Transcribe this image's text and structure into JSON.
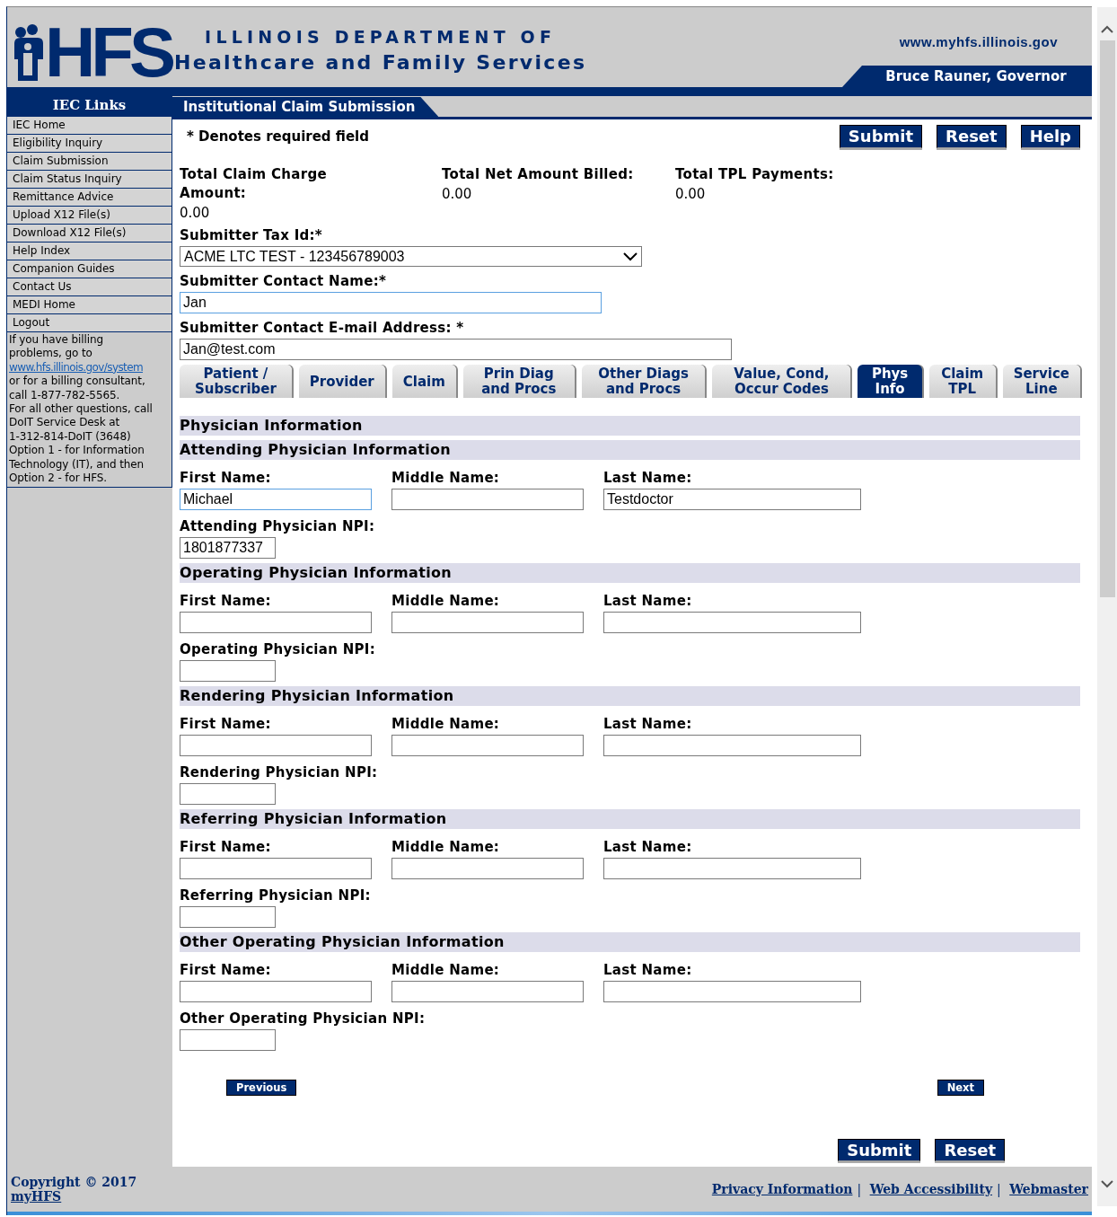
{
  "header": {
    "logo_text": "HFS",
    "title_line1": "ILLINOIS DEPARTMENT OF",
    "title_line2": "Healthcare and Family Services",
    "url": "www.myhfs.illinois.gov",
    "governor": "Bruce Rauner, Governor"
  },
  "sidebar": {
    "title": "IEC Links",
    "items": [
      "IEC Home",
      "Eligibility Inquiry",
      "Claim Submission",
      "Claim Status Inquiry",
      "Remittance Advice",
      "Upload X12 File(s)",
      "Download X12 File(s)",
      "Help Index",
      "Companion Guides",
      "Contact Us",
      "MEDI Home",
      "Logout"
    ],
    "note_before": [
      "If you have billing",
      "problems, go to"
    ],
    "note_link": "www.hfs.illinois.gov/system",
    "note_after": [
      "or for a billing consultant,",
      "call 1-877-782-5565.",
      "For all other questions, call",
      "DoIT Service Desk at",
      "1-312-814-DoIT (3648)",
      "Option 1 - for Information",
      "Technology (IT), and then",
      "Option 2 - for HFS."
    ]
  },
  "page_tab": "Institutional Claim Submission",
  "required_note": "* Denotes required field",
  "top_buttons": [
    "Submit",
    "Reset",
    "Help"
  ],
  "totals": [
    {
      "label": "Total Claim Charge Amount:",
      "value": "0.00"
    },
    {
      "label": "Total Net Amount Billed:",
      "value": "0.00"
    },
    {
      "label": "Total TPL Payments:",
      "value": "0.00"
    }
  ],
  "tax_id": {
    "label": "Submitter Tax Id:*",
    "value": "ACME LTC TEST - 123456789003"
  },
  "contact_name": {
    "label": "Submitter Contact Name:*",
    "value": "Jan"
  },
  "contact_email": {
    "label": "Submitter Contact E-mail Address: *",
    "value": "Jan@test.com"
  },
  "tabs": [
    {
      "label": "Patient / Subscriber",
      "selected": false
    },
    {
      "label": "Provider",
      "selected": false
    },
    {
      "label": "Claim",
      "selected": false
    },
    {
      "label": "Prin Diag and Procs",
      "selected": false
    },
    {
      "label": "Other Diags and Procs",
      "selected": false
    },
    {
      "label": "Value, Cond, Occur Codes",
      "selected": false
    },
    {
      "label": "Phys Info",
      "selected": true
    },
    {
      "label": "Claim TPL",
      "selected": false
    },
    {
      "label": "Service Line",
      "selected": false
    }
  ],
  "section_title": "Physician Information",
  "sections": [
    {
      "title": "Attending Physician Information",
      "fields": [
        {
          "label": "First Name:",
          "value": "Michael"
        },
        {
          "label": "Middle Name:"
        },
        {
          "label": "Last Name:",
          "value": "Testdoctor"
        }
      ],
      "npi_label": "Attending Physician NPI:",
      "npi_value": "1801877337"
    },
    {
      "title": "Operating Physician Information",
      "fields": [
        {
          "label": "First Name:"
        },
        {
          "label": "Middle Name:"
        },
        {
          "label": "Last Name:"
        }
      ],
      "npi_label": "Operating Physician NPI:"
    },
    {
      "title": "Rendering Physician Information",
      "fields": [
        {
          "label": "First Name:"
        },
        {
          "label": "Middle Name:"
        },
        {
          "label": "Last Name:"
        }
      ],
      "npi_label": "Rendering Physician NPI:"
    },
    {
      "title": "Referring Physician Information",
      "fields": [
        {
          "label": "First Name:"
        },
        {
          "label": "Middle Name:"
        },
        {
          "label": "Last Name:"
        }
      ],
      "npi_label": "Referring Physician NPI:"
    },
    {
      "title": "Other Operating Physician Information",
      "fields": [
        {
          "label": "First Name:"
        },
        {
          "label": "Middle Name:"
        },
        {
          "label": "Last Name:"
        }
      ],
      "npi_label": "Other Operating Physician NPI:"
    }
  ],
  "nav_buttons": {
    "previous": "Previous",
    "next": "Next"
  },
  "bottom_buttons": [
    "Submit",
    "Reset"
  ],
  "footer": {
    "copyright": "Copyright © 2017",
    "site_link": "myHFS",
    "links": [
      "Privacy Information",
      "Web Accessibility",
      "Webmaster"
    ],
    "separator": "|"
  }
}
